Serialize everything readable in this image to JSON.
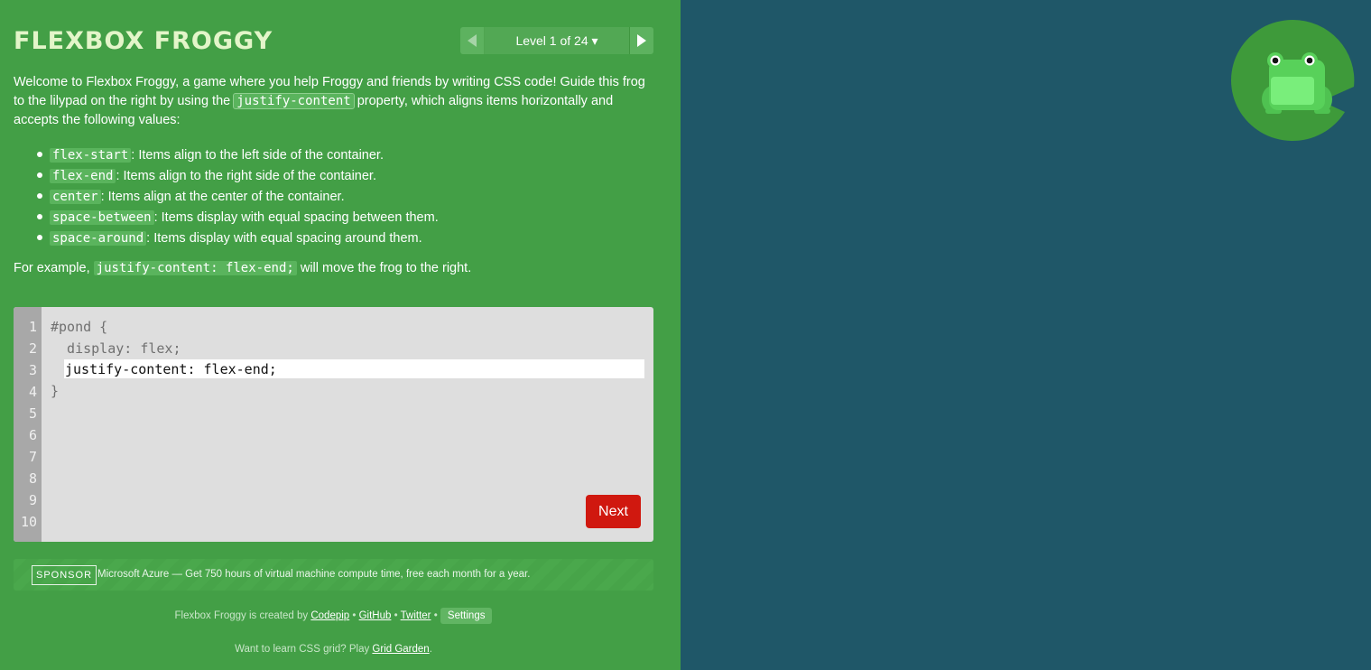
{
  "header": {
    "title": "Flexbox Froggy",
    "level_label": "Level 1 of 24 ▾"
  },
  "instructions": {
    "intro_part1": "Welcome to Flexbox Froggy, a game where you help Froggy and friends by writing CSS code! Guide this frog to the lilypad on the right by using the ",
    "intro_code": "justify-content",
    "intro_part2": " property, which aligns items horizontally and accepts the following values:",
    "values": [
      {
        "code": "flex-start",
        "desc": ": Items align to the left side of the container."
      },
      {
        "code": "flex-end",
        "desc": ": Items align to the right side of the container."
      },
      {
        "code": "center",
        "desc": ": Items align at the center of the container."
      },
      {
        "code": "space-between",
        "desc": ": Items display with equal spacing between them."
      },
      {
        "code": "space-around",
        "desc": ": Items display with equal spacing around them."
      }
    ],
    "example_prefix": "For example, ",
    "example_code": "justify-content: flex-end;",
    "example_suffix": " will move the frog to the right."
  },
  "editor": {
    "line_numbers": [
      "1",
      "2",
      "3",
      "4",
      "5",
      "6",
      "7",
      "8",
      "9",
      "10"
    ],
    "line1": "#pond {",
    "line2": "  display: flex;",
    "input_value": "justify-content: flex-end;",
    "line4": "}",
    "next_label": "Next"
  },
  "sponsor": {
    "badge": "SPONSOR",
    "text": "Microsoft Azure — Get 750 hours of virtual machine compute time, free each month for a year."
  },
  "footer": {
    "created_by": "Flexbox Froggy is created by ",
    "codepip": "Codepip",
    "sep": " • ",
    "github": "GitHub",
    "twitter": "Twitter",
    "settings": "Settings",
    "grid_prefix": "Want to learn CSS grid? Play ",
    "grid_link": "Grid Garden",
    "grid_suffix": "."
  },
  "colors": {
    "sidebar": "#439f46",
    "pond": "#1f5768",
    "lilypad": "#3e9a3a",
    "frog": "#58d15a",
    "next_button": "#d0180f"
  }
}
